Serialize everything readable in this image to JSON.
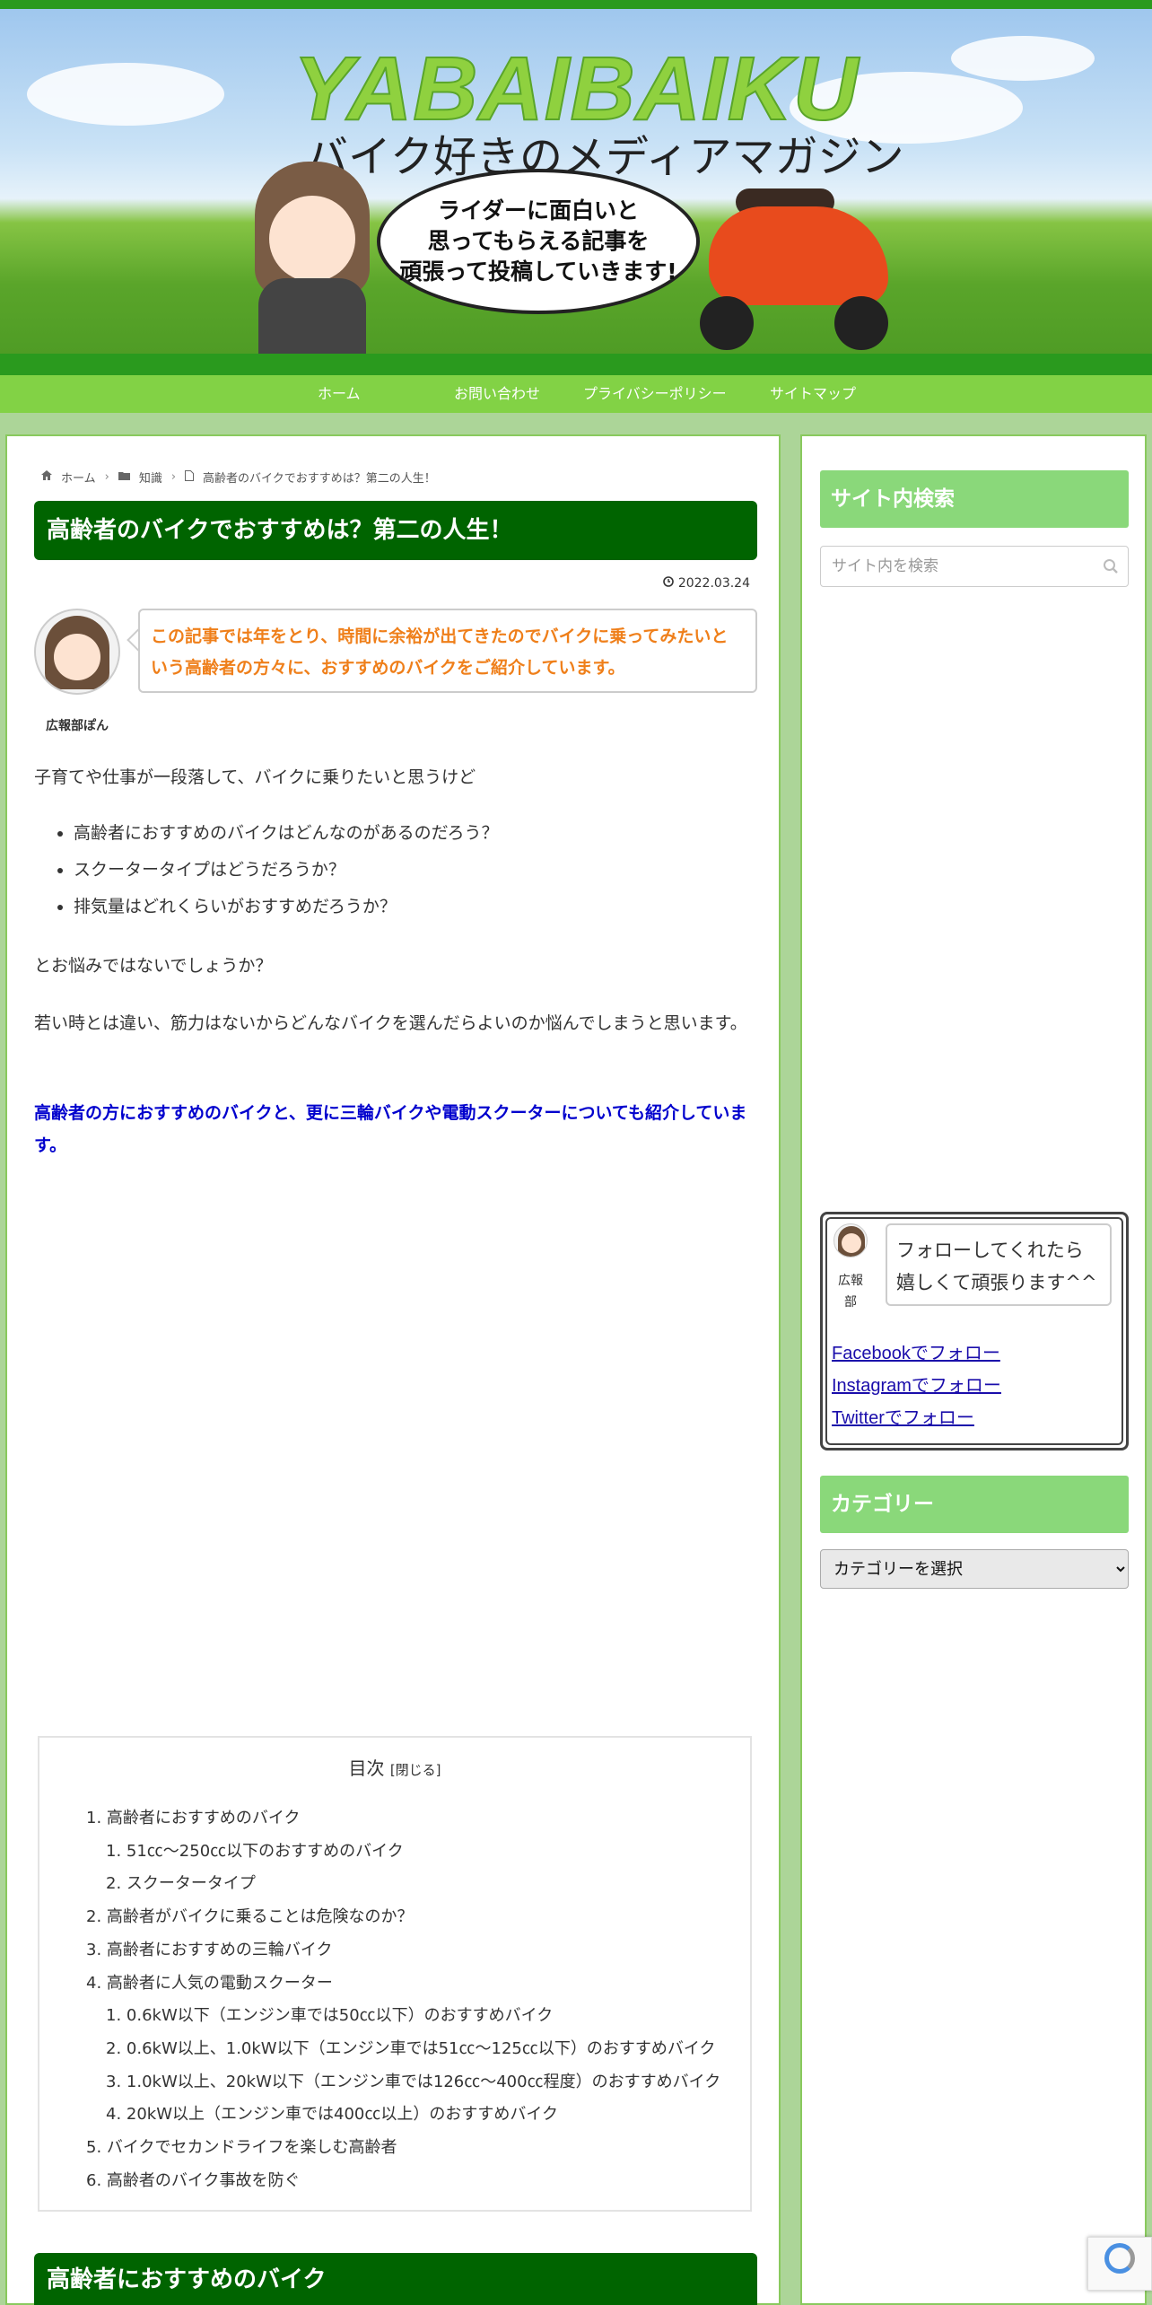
{
  "header": {
    "title": "YABAIBAIKU",
    "subtitle": "バイク好きのメディアマガジン",
    "bubble_line1": "ライダーに面白いと",
    "bubble_line2": "思ってもらえる記事を",
    "bubble_line3": "頑張って投稿していきます!"
  },
  "nav": {
    "items": [
      "ホーム",
      "お問い合わせ",
      "プライバシーポリシー",
      "サイトマップ"
    ]
  },
  "breadcrumb": {
    "home": "ホーム",
    "category": "知識",
    "current": "高齢者のバイクでおすすめは？第二の人生！"
  },
  "article": {
    "title": "高齢者のバイクでおすすめは？第二の人生！",
    "date": "2022.03.24",
    "author_name": "広報部ぽん",
    "speech": "この記事では年をとり、時間に余裕が出てきたのでバイクに乗ってみたいという高齢者の方々に、おすすめのバイクをご紹介しています。",
    "p1": "子育てや仕事が一段落して、バイクに乗りたいと思うけど",
    "bullets": [
      "高齢者におすすめのバイクはどんなのがあるのだろう？",
      "スクータータイプはどうだろうか？",
      "排気量はどれくらいがおすすめだろうか？"
    ],
    "p2": "とお悩みではないでしょうか？",
    "p3": "若い時とは違い、筋力はないからどんなバイクを選んだらよいのか悩んでしまうと思います。",
    "p4": "高齢者の方におすすめのバイクと、更に三輪バイクや電動スクーターについても紹介しています。",
    "h2": "高齢者におすすめのバイク"
  },
  "toc": {
    "title": "目次",
    "toggle": "[閉じる]",
    "items": [
      "1. 高齢者におすすめのバイク",
      "1. 51㏄～250㏄以下のおすすめのバイク",
      "2. スクータータイプ",
      "2. 高齢者がバイクに乗ることは危険なのか？",
      "3. 高齢者におすすめの三輪バイク",
      "4. 高齢者に人気の電動スクーター",
      "1. 0.6kW以下（エンジン車では50㏄以下）のおすすめバイク",
      "2. 0.6kW以上、1.0kW以下（エンジン車では51㏄～125㏄以下）のおすすめバイク",
      "3. 1.0kW以上、20kW以下（エンジン車では126㏄～400㏄程度）のおすすめバイク",
      "4. 20kW以上（エンジン車では400㏄以上）のおすすめバイク",
      "5. バイクでセカンドライフを楽しむ高齢者",
      "6. 高齢者のバイク事故を防ぐ"
    ]
  },
  "sidebar": {
    "search_heading": "サイト内検索",
    "search_placeholder": "サイト内を検索",
    "follow_name": "広報部",
    "follow_bubble": "フォローしてくれたら嬉しくて頑張ります^^",
    "links": [
      "Facebookでフォロー",
      "Instagramでフォロー",
      "Twitterでフォロー"
    ],
    "category_heading": "カテゴリー",
    "category_select": "カテゴリーを選択"
  },
  "colors": {
    "brand_green": "#006400",
    "nav_green": "#82d245",
    "accent_orange": "#ef7f1a",
    "accent_blue": "#0000cd"
  }
}
